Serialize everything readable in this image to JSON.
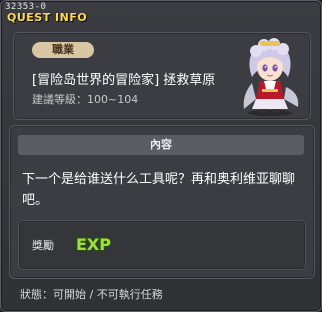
{
  "window": {
    "quest_id": "32353-0",
    "title": "QUEST INFO"
  },
  "quest": {
    "job_badge": "職業",
    "name": "[冒险岛世界的冒险家] 拯救草原",
    "level": "建議等級：100~104"
  },
  "content": {
    "header": "內容",
    "description": "下一个是给谁送什么工具呢？再和奥利维亚聊聊吧。"
  },
  "reward": {
    "label": "獎勵",
    "exp_text": "EXP"
  },
  "status": "狀態：可開始 / 不可執行任務",
  "icons": {
    "character": "npc-portrait-icon",
    "exp": "exp-reward-icon"
  }
}
